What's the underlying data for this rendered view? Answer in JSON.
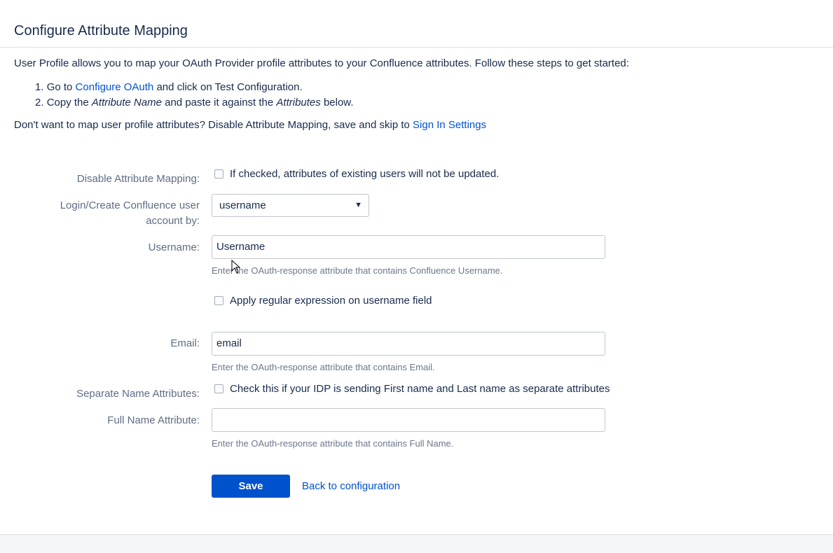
{
  "page": {
    "title": "Configure Attribute Mapping",
    "intro": "User Profile allows you to map your OAuth Provider profile attributes to your Confluence attributes. Follow these steps to get started:",
    "steps": [
      {
        "num": "1.",
        "prefix": "Go to ",
        "link": "Configure OAuth",
        "suffix": " and click on Test Configuration."
      },
      {
        "num": "2.",
        "prefix": "Copy the ",
        "em1": "Attribute Name",
        "mid": " and paste it against the ",
        "em2": "Attributes",
        "suffix": " below."
      }
    ],
    "skip_text": "Don't want to map user profile attributes? Disable Attribute Mapping, save and skip to ",
    "skip_link": "Sign In Settings"
  },
  "form": {
    "disable_mapping": {
      "label": "Disable Attribute Mapping:",
      "checkbox_text": "If checked, attributes of existing users will not be updated.",
      "checked": false
    },
    "login_by": {
      "label_line1": "Login/Create Confluence user",
      "label_line2": "account by:",
      "selected": "username"
    },
    "username": {
      "label": "Username:",
      "value": "Username",
      "hint": "Enter the OAuth-response attribute that contains Confluence Username."
    },
    "regex": {
      "checkbox_text": "Apply regular expression on username field",
      "checked": false
    },
    "email": {
      "label": "Email:",
      "value": "email",
      "hint": "Enter the OAuth-response attribute that contains Email."
    },
    "separate_name": {
      "label": "Separate Name Attributes:",
      "checkbox_text": "Check this if your IDP is sending First name and Last name as separate attributes",
      "checked": false
    },
    "full_name": {
      "label": "Full Name Attribute:",
      "value": "",
      "hint": "Enter the OAuth-response attribute that contains Full Name."
    },
    "save_label": "Save",
    "back_label": "Back to configuration"
  },
  "colors": {
    "accent": "#0052cc",
    "text": "#172b4d",
    "muted": "#5e6c84"
  },
  "icons": {
    "select_caret": "chevron-down-icon",
    "cursor": "mouse-pointer-icon"
  }
}
